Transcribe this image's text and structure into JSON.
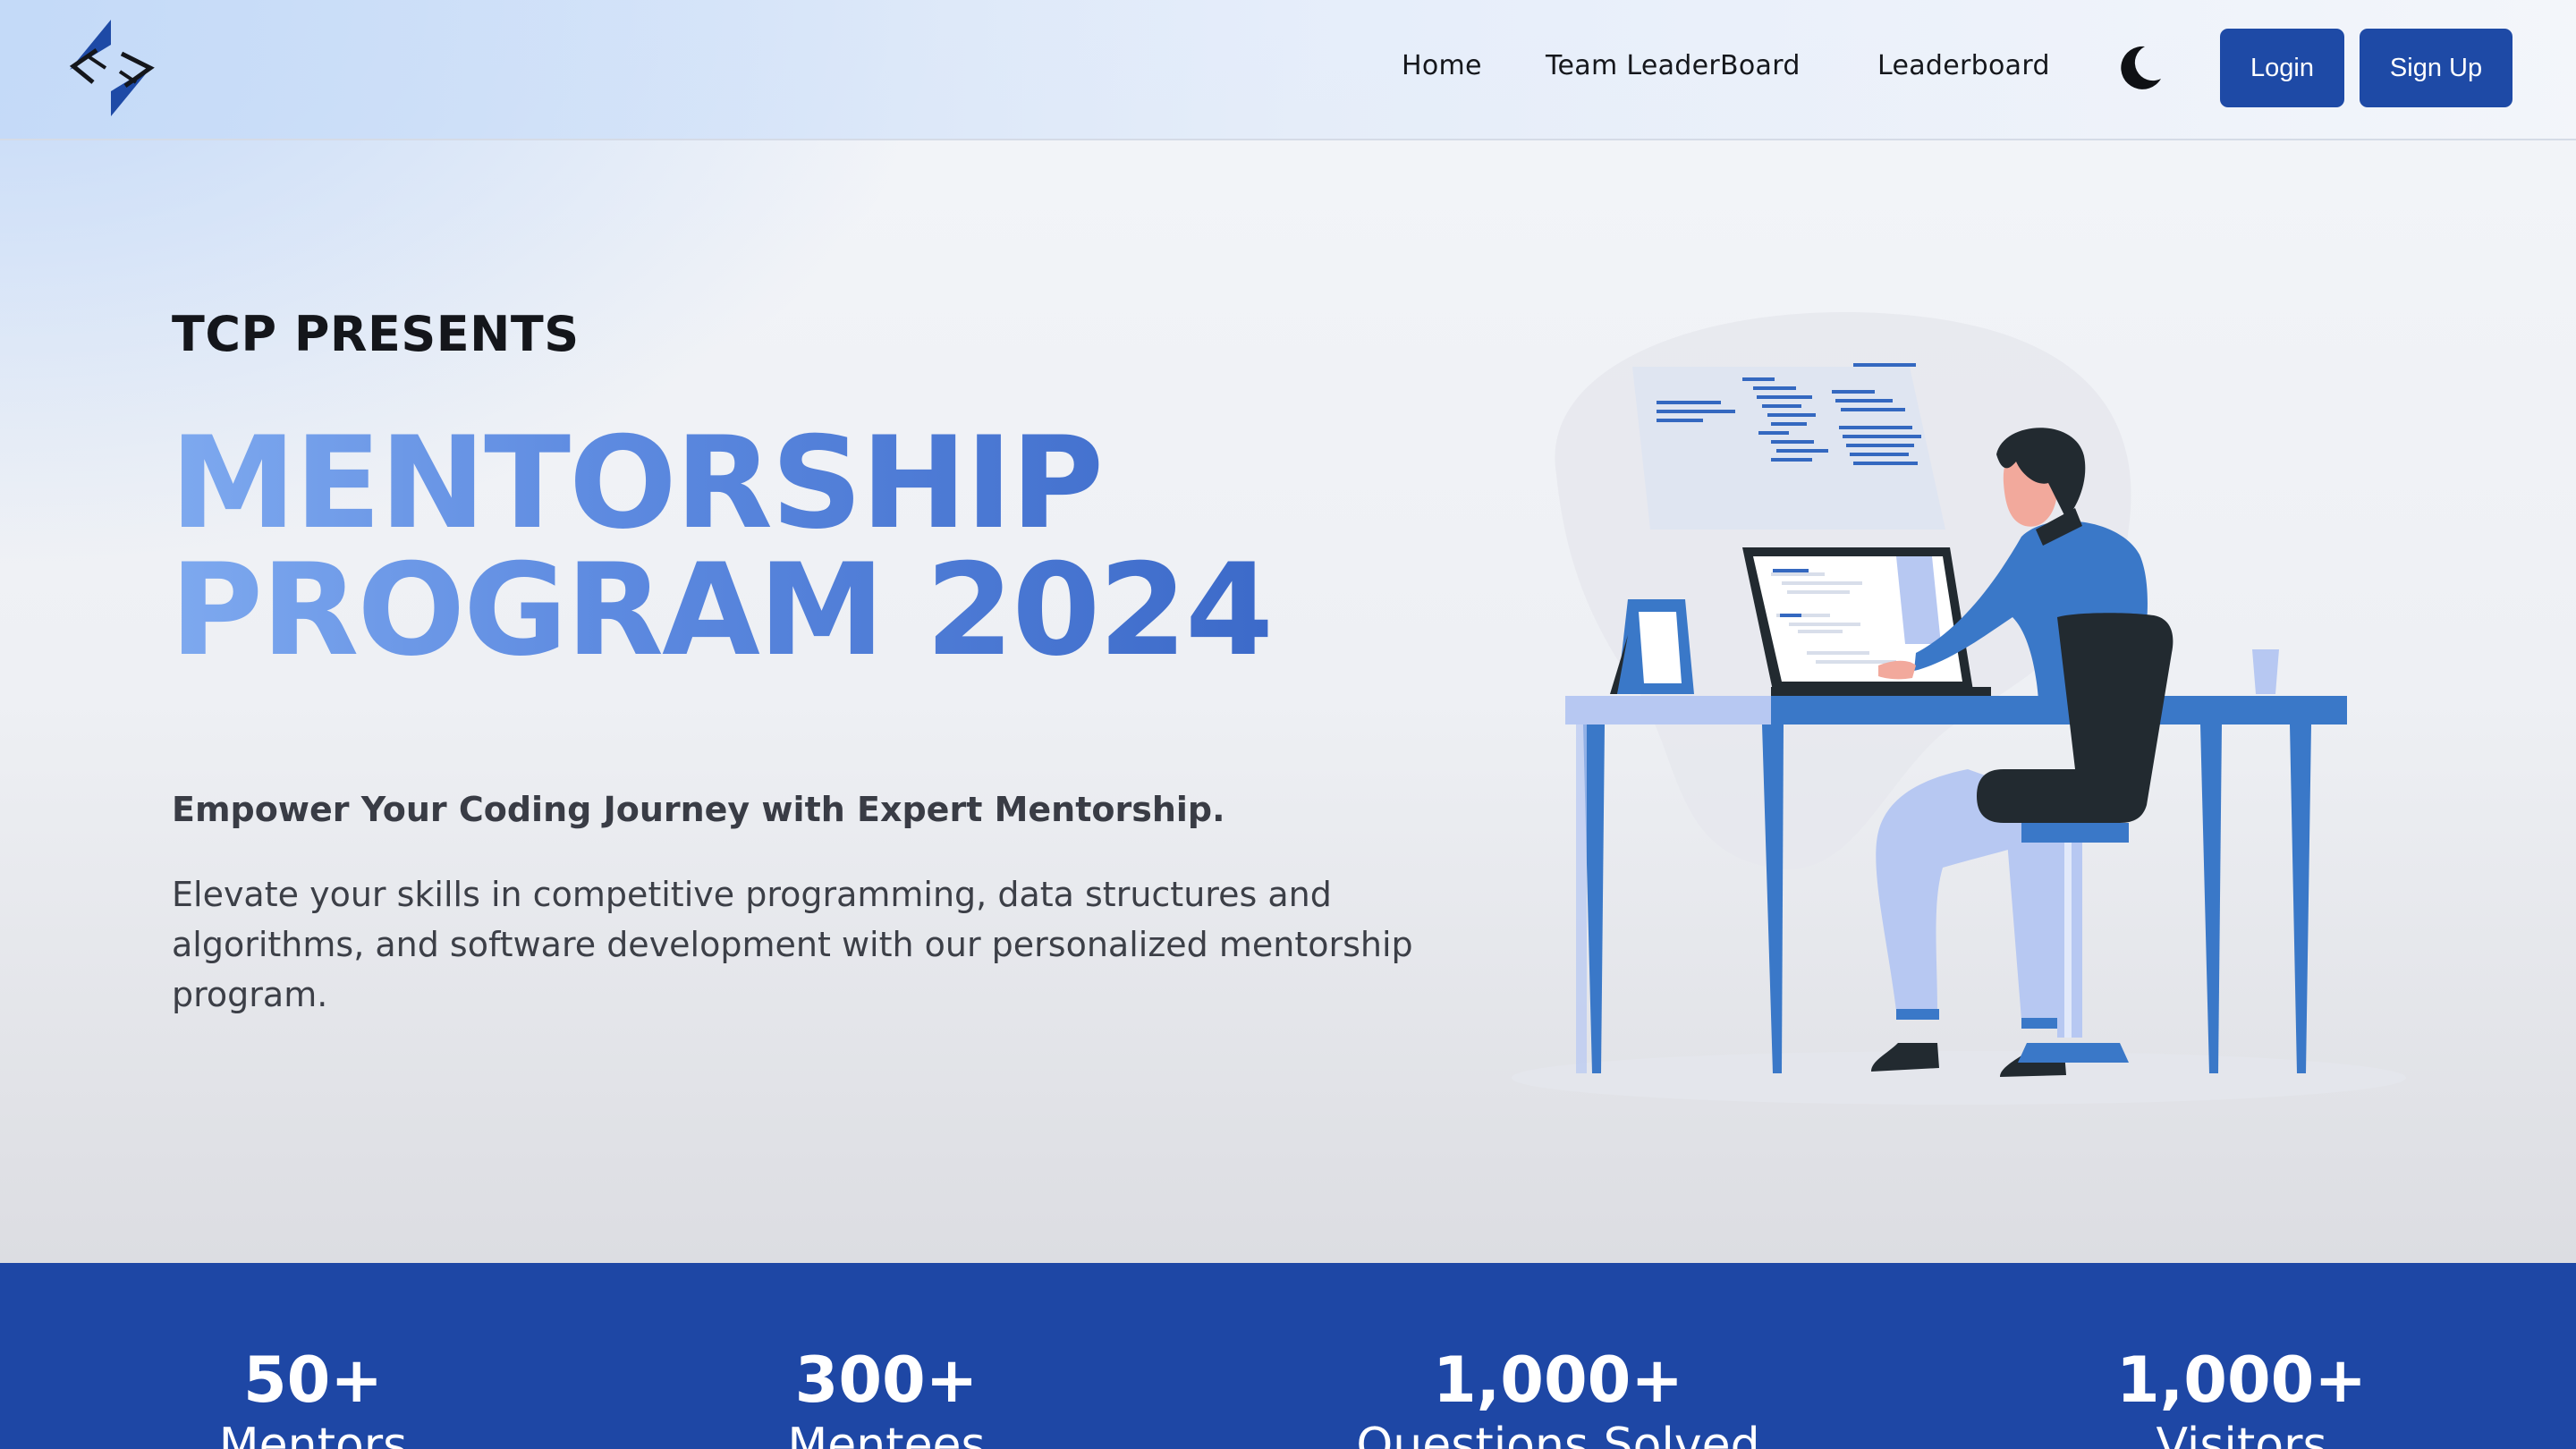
{
  "nav": {
    "links": [
      {
        "label": "Home"
      },
      {
        "label": "Team LeaderBoard"
      },
      {
        "label": "Leaderboard"
      }
    ],
    "theme_toggle_icon": "moon-icon",
    "login_label": "Login",
    "signup_label": "Sign Up"
  },
  "hero": {
    "kicker": "TCP PRESENTS",
    "title_line1": "MENTORSHIP",
    "title_line2": "PROGRAM 2024",
    "subheading": "Empower Your Coding Journey with Expert Mentorship.",
    "description": "Elevate your skills in competitive programming, data structures and algorithms, and software development with our personalized mentorship program."
  },
  "stats": [
    {
      "value": "50+",
      "label": "Mentors"
    },
    {
      "value": "300+",
      "label": "Mentees"
    },
    {
      "value": "1,000+",
      "label": "Questions Solved"
    },
    {
      "value": "1,000+",
      "label": "Visitors"
    }
  ],
  "colors": {
    "brand": "#1e4aa6",
    "stats_band": "#1e47a5",
    "title_gradient_start": "#7ea9ef",
    "title_gradient_end": "#3c6ac9",
    "illustration_blue": "#3a78c8",
    "illustration_light": "#b7c8f2",
    "illustration_dark": "#222a30"
  }
}
